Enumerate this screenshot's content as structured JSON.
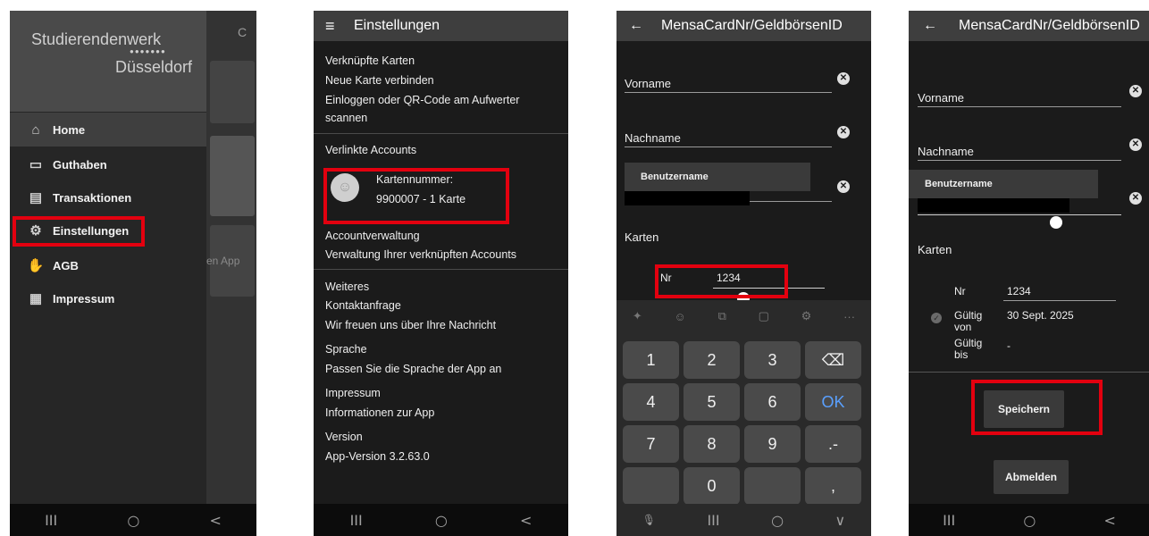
{
  "screen1": {
    "logo_line1": "Studierendenwerk",
    "logo_dots": "●●●●●●●",
    "logo_line2": "Düsseldorf",
    "menu": [
      {
        "label": "Home",
        "icon": "⌂"
      },
      {
        "label": "Guthaben",
        "icon": "▭"
      },
      {
        "label": "Transaktionen",
        "icon": "▤"
      },
      {
        "label": "Einstellungen",
        "icon": "⚙"
      },
      {
        "label": "AGB",
        "icon": "✋"
      },
      {
        "label": "Impressum",
        "icon": "▦"
      }
    ],
    "background_text": "en App",
    "refresh_icon": "C"
  },
  "screen2": {
    "title": "Einstellungen",
    "menu_icon": "≡",
    "section_linked_cards": "Verknüpfte Karten",
    "new_card": "Neue Karte verbinden",
    "login_qr_line1": "Einloggen oder QR-Code am Aufwerter",
    "login_qr_line2": "scannen",
    "section_linked_accounts": "Verlinkte Accounts",
    "card_number_label": "Kartennummer:",
    "card_number_value": "9900007 - 1 Karte",
    "account_management": "Accountverwaltung",
    "account_management_desc": "Verwaltung Ihrer verknüpften Accounts",
    "further": "Weiteres",
    "contact": "Kontaktanfrage",
    "contact_desc": "Wir freuen uns über Ihre Nachricht",
    "language": "Sprache",
    "language_desc": "Passen Sie die Sprache der App an",
    "imprint": "Impressum",
    "imprint_desc": "Informationen zur App",
    "version": "Version",
    "version_value": "App-Version 3.2.63.0"
  },
  "screen3": {
    "title": "MensaCardNr/GeldbörsenID",
    "back_icon": "←",
    "first_name": "Vorname",
    "last_name": "Nachname",
    "username_tooltip": "Benutzername",
    "cards": "Karten",
    "nr_label": "Nr",
    "nr_value": "1234",
    "keys": [
      "1",
      "2",
      "3",
      "⌫",
      "4",
      "5",
      "6",
      "OK",
      "7",
      "8",
      "9",
      ".-",
      "",
      "0",
      ","
    ],
    "tools": [
      "✦",
      "☺",
      "⧉",
      "▢",
      "⚙",
      "···"
    ]
  },
  "screen4": {
    "title": "MensaCardNr/GeldbörsenID",
    "back_icon": "←",
    "first_name": "Vorname",
    "last_name": "Nachname",
    "username_tooltip": "Benutzername",
    "cards": "Karten",
    "nr_label": "Nr",
    "nr_value": "1234",
    "valid_from_label_1": "Gültig",
    "valid_from_label_2": "von",
    "valid_from_value": "30 Sept. 2025",
    "valid_to_label_1": "Gültig",
    "valid_to_label_2": "bis",
    "valid_to_value": "-",
    "save_button": "Speichern",
    "logout_button": "Abmelden"
  },
  "navbar": {
    "recents": "III",
    "home": "○",
    "back": "<",
    "down": "∨",
    "mic": "🎙"
  },
  "highlight_color": "#e3000f"
}
